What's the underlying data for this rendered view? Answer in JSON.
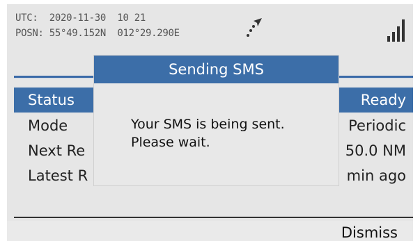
{
  "header": {
    "utc_line": "UTC:  2020-11-30  10 21",
    "posn_line": "POSN: 55°49.152N  012°29.290E",
    "compass_icon": "compass-heading-icon",
    "signal_icon": "signal-strength-icon"
  },
  "table": {
    "rows": [
      {
        "label": "Status",
        "value": "Ready"
      },
      {
        "label": "Mode",
        "value": "Periodic"
      },
      {
        "label": "Next Re",
        "value": "50.0 NM"
      },
      {
        "label": "Latest R",
        "value": "min ago"
      }
    ]
  },
  "dialog": {
    "title": "Sending SMS",
    "line1": "Your SMS is being sent.",
    "line2": "Please wait."
  },
  "softkeys": {
    "dismiss_label": "Dismiss"
  },
  "colors": {
    "accent": "#3c6ea8",
    "background": "#e6e6e6"
  }
}
